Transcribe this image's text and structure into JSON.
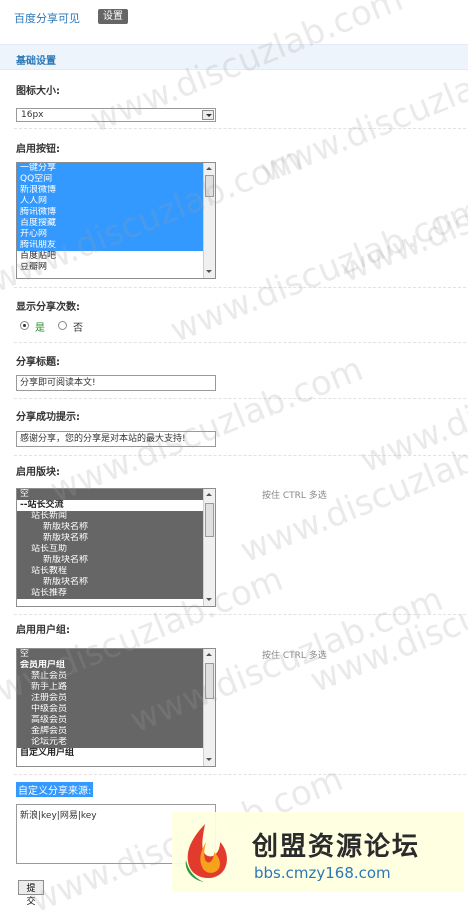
{
  "header": {
    "title": "百度分享可见",
    "badge": "设置"
  },
  "section": {
    "title": "基础设置"
  },
  "icon_size": {
    "label": "图标大小:",
    "value": "16px"
  },
  "buttons_enabled": {
    "label": "启用按钮:",
    "items": [
      "一键分享",
      "QQ空间",
      "新浪微博",
      "人人网",
      "腾讯微博",
      "百度搜藏",
      "开心网",
      "腾讯朋友",
      "百度贴吧",
      "豆瓣网"
    ],
    "selected_count": 8
  },
  "show_count": {
    "label": "显示分享次数:",
    "yes": "是",
    "no": "否",
    "selected": "是"
  },
  "share_title": {
    "label": "分享标题:",
    "value": "分享即可阅读本文!"
  },
  "share_success": {
    "label": "分享成功提示:",
    "value": "感谢分享，您的分享是对本站的最大支持!"
  },
  "enabled_boards": {
    "label": "启用版块:",
    "hint": "按住 CTRL 多选",
    "items": [
      {
        "text": "空",
        "level": 0
      },
      {
        "text": "--站长交流",
        "level": 0
      },
      {
        "text": "站长新闻",
        "level": 1
      },
      {
        "text": "新版块名称",
        "level": 2
      },
      {
        "text": "新版块名称",
        "level": 2
      },
      {
        "text": "站长互助",
        "level": 1
      },
      {
        "text": "新版块名称",
        "level": 2
      },
      {
        "text": "站长教程",
        "level": 1
      },
      {
        "text": "新版块名称",
        "level": 2
      },
      {
        "text": "站长推荐",
        "level": 1
      }
    ]
  },
  "enabled_groups": {
    "label": "启用用户组:",
    "hint": "按住 CTRL 多选",
    "items": [
      {
        "text": "空",
        "level": 0,
        "bold": false,
        "selected": true
      },
      {
        "text": "会员用户组",
        "level": 0,
        "bold": true,
        "selected": true
      },
      {
        "text": "禁止会员",
        "level": 1,
        "bold": false,
        "selected": true
      },
      {
        "text": "新手上路",
        "level": 1,
        "bold": false,
        "selected": true
      },
      {
        "text": "注册会员",
        "level": 1,
        "bold": false,
        "selected": true
      },
      {
        "text": "中级会员",
        "level": 1,
        "bold": false,
        "selected": true
      },
      {
        "text": "高级会员",
        "level": 1,
        "bold": false,
        "selected": true
      },
      {
        "text": "金牌会员",
        "level": 1,
        "bold": false,
        "selected": true
      },
      {
        "text": "论坛元老",
        "level": 1,
        "bold": false,
        "selected": true
      },
      {
        "text": "自定义用户组",
        "level": 0,
        "bold": true,
        "selected": false
      }
    ]
  },
  "custom_source": {
    "label": "自定义分享来源:",
    "value": "新浪|key|网易|key"
  },
  "submit": {
    "label": "提交"
  },
  "watermark": {
    "text": "www.discuzlab.com"
  },
  "overlay": {
    "title": "创盟资源论坛",
    "url": "bbs.cmzy168.com"
  }
}
